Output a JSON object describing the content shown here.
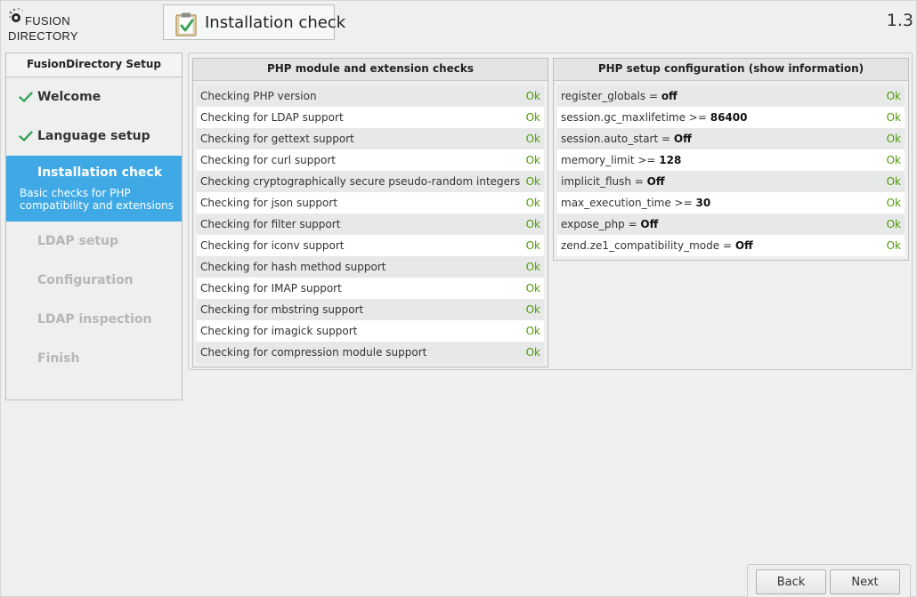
{
  "logo": {
    "line1": "FUSION",
    "line2": "DIRECTORY"
  },
  "header": {
    "title": "Installation check",
    "version": "1.3"
  },
  "sidebar": {
    "title": "FusionDirectory Setup",
    "steps": [
      {
        "label": "Welcome",
        "state": "done"
      },
      {
        "label": "Language setup",
        "state": "done"
      },
      {
        "label": "Installation check",
        "state": "active",
        "description": "Basic checks for PHP compatibility and extensions"
      },
      {
        "label": "LDAP setup",
        "state": "todo"
      },
      {
        "label": "Configuration",
        "state": "todo"
      },
      {
        "label": "LDAP inspection",
        "state": "todo"
      },
      {
        "label": "Finish",
        "state": "todo"
      }
    ]
  },
  "php_checks": {
    "title": "PHP module and extension checks",
    "rows": [
      {
        "label": "Checking PHP version",
        "status": "Ok"
      },
      {
        "label": "Checking for LDAP support",
        "status": "Ok"
      },
      {
        "label": "Checking for gettext support",
        "status": "Ok"
      },
      {
        "label": "Checking for curl support",
        "status": "Ok"
      },
      {
        "label": "Checking cryptographically secure pseudo-random integers",
        "status": "Ok"
      },
      {
        "label": "Checking for json support",
        "status": "Ok"
      },
      {
        "label": "Checking for filter support",
        "status": "Ok"
      },
      {
        "label": "Checking for iconv support",
        "status": "Ok"
      },
      {
        "label": "Checking for hash method support",
        "status": "Ok"
      },
      {
        "label": "Checking for IMAP support",
        "status": "Ok"
      },
      {
        "label": "Checking for mbstring support",
        "status": "Ok"
      },
      {
        "label": "Checking for imagick support",
        "status": "Ok"
      },
      {
        "label": "Checking for compression module support",
        "status": "Ok"
      }
    ]
  },
  "php_config": {
    "title": "PHP setup configuration (show information)",
    "rows": [
      {
        "key": "register_globals = ",
        "value": "off",
        "status": "Ok"
      },
      {
        "key": "session.gc_maxlifetime >= ",
        "value": "86400",
        "status": "Ok"
      },
      {
        "key": "session.auto_start = ",
        "value": "Off",
        "status": "Ok"
      },
      {
        "key": "memory_limit >= ",
        "value": "128",
        "status": "Ok"
      },
      {
        "key": "implicit_flush = ",
        "value": "Off",
        "status": "Ok"
      },
      {
        "key": "max_execution_time >= ",
        "value": "30",
        "status": "Ok"
      },
      {
        "key": "expose_php = ",
        "value": "Off",
        "status": "Ok"
      },
      {
        "key": "zend.ze1_compatibility_mode = ",
        "value": "Off",
        "status": "Ok"
      }
    ]
  },
  "footer": {
    "back_label": "Back",
    "next_label": "Next"
  },
  "colors": {
    "accent": "#3fa9e6",
    "ok": "#4e9a06",
    "check": "#3aa35a"
  }
}
